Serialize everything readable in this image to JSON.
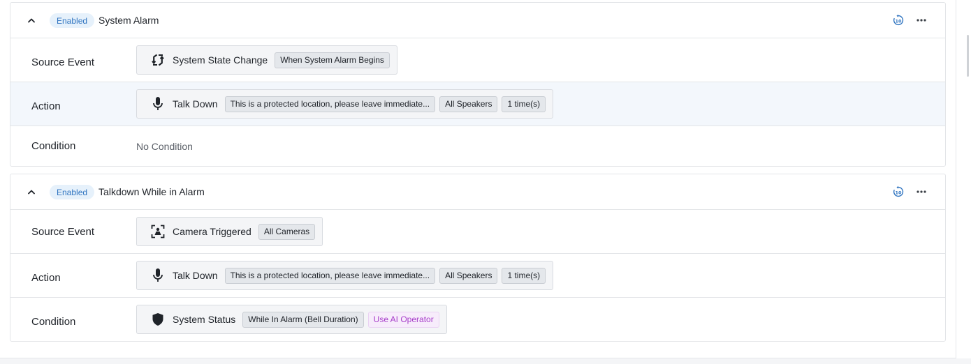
{
  "rules": [
    {
      "status": "Enabled",
      "title": "System Alarm",
      "rows": {
        "source": {
          "label": "Source Event",
          "icon": "system-state-icon",
          "name": "System State Change",
          "tags": [
            "When System Alarm Begins"
          ]
        },
        "action": {
          "label": "Action",
          "icon": "microphone-icon",
          "name": "Talk Down",
          "tags": [
            "This is a protected location, please leave immediate...",
            "All Speakers",
            "1 time(s)"
          ]
        },
        "condition": {
          "label": "Condition",
          "text": "No Condition"
        }
      }
    },
    {
      "status": "Enabled",
      "title": "Talkdown While in Alarm",
      "rows": {
        "source": {
          "label": "Source Event",
          "icon": "camera-triggered-icon",
          "name": "Camera Triggered",
          "tags": [
            "All Cameras"
          ]
        },
        "action": {
          "label": "Action",
          "icon": "microphone-icon",
          "name": "Talk Down",
          "tags": [
            "This is a protected location, please leave immediate...",
            "All Speakers",
            "1 time(s)"
          ]
        },
        "condition": {
          "label": "Condition",
          "icon": "shield-icon",
          "name": "System Status",
          "tags": [
            "While In Alarm (Bell Duration)"
          ],
          "ai_tag": "Use AI Operator"
        }
      }
    }
  ],
  "colors": {
    "accent": "#2f74c0",
    "ai": "#a63cc9",
    "highlight_row": "#f3f7fc"
  }
}
